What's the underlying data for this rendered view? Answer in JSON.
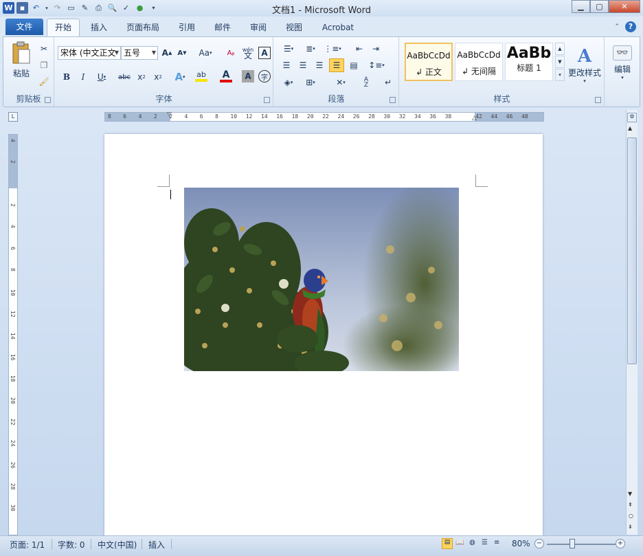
{
  "window": {
    "title": "文档1 - Microsoft Word"
  },
  "tabs": {
    "file": "文件",
    "items": [
      "开始",
      "插入",
      "页面布局",
      "引用",
      "邮件",
      "审阅",
      "视图",
      "Acrobat"
    ]
  },
  "ribbon": {
    "clipboard": {
      "label": "剪贴板",
      "paste": "粘贴"
    },
    "font": {
      "label": "字体",
      "font_name": "宋体 (中文正文",
      "font_size": "五号",
      "change_case": "Aa",
      "wen": "wén",
      "wen2": "文"
    },
    "paragraph": {
      "label": "段落"
    },
    "styles": {
      "label": "样式",
      "items": [
        {
          "sample": "AaBbCcDd",
          "name": "↲ 正文"
        },
        {
          "sample": "AaBbCcDd",
          "name": "↲ 无间隔"
        },
        {
          "sample": "AaBb",
          "name": "标题 1"
        }
      ],
      "change_styles": "更改样式"
    },
    "editing": {
      "label": "编辑"
    }
  },
  "ruler": {
    "h_ticks": [
      "8",
      "6",
      "4",
      "2",
      "2",
      "4",
      "6",
      "8",
      "10",
      "12",
      "14",
      "16",
      "18",
      "20",
      "22",
      "24",
      "26",
      "28",
      "30",
      "32",
      "34",
      "36",
      "38",
      "42",
      "44",
      "46",
      "48"
    ],
    "v_ticks": [
      "4",
      "2",
      "2",
      "4",
      "6",
      "8",
      "10",
      "12",
      "14",
      "16",
      "18",
      "20",
      "22",
      "24",
      "26",
      "28",
      "30"
    ]
  },
  "status": {
    "page": "页面: 1/1",
    "words": "字数: 0",
    "language": "中文(中国)",
    "mode": "插入",
    "zoom": "80%"
  },
  "colors": {
    "file_tab": "#2b6cc0",
    "font_color_bar": "#e00000",
    "highlight_bar": "#f5e400"
  }
}
